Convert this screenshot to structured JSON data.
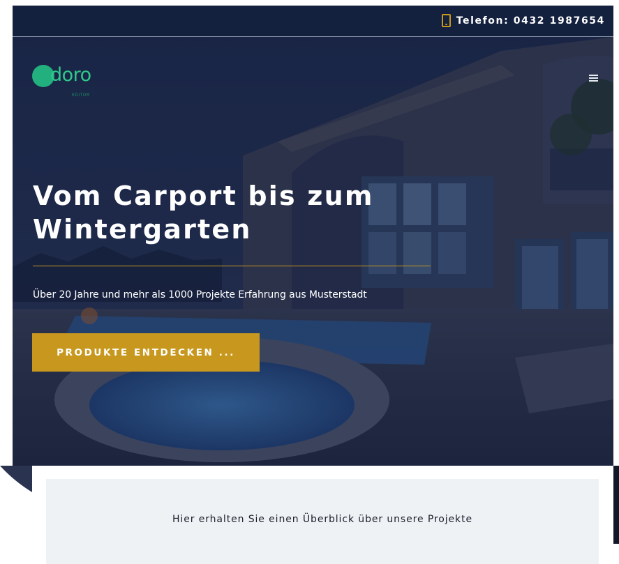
{
  "topbar": {
    "phone_icon": "phone-icon",
    "phone_text": "Telefon: 0432 1987654"
  },
  "header": {
    "logo_text": "doro",
    "logo_sub": "EDITOR",
    "menu_icon": "hamburger-menu-icon"
  },
  "hero": {
    "title": "Vom Carport bis zum Wintergarten",
    "subtitle": "Über 20 Jahre und mehr als 1000 Projekte Erfahrung aus Musterstadt",
    "cta_label": "PRODUKTE ENTDECKEN ..."
  },
  "info": {
    "text": "Hier erhalten Sie einen Überblick über unsere Projekte"
  },
  "colors": {
    "navy": "#13203e",
    "gold": "#c8981e",
    "logo_green": "#2fc98a",
    "card_bg": "#eff2f5"
  }
}
